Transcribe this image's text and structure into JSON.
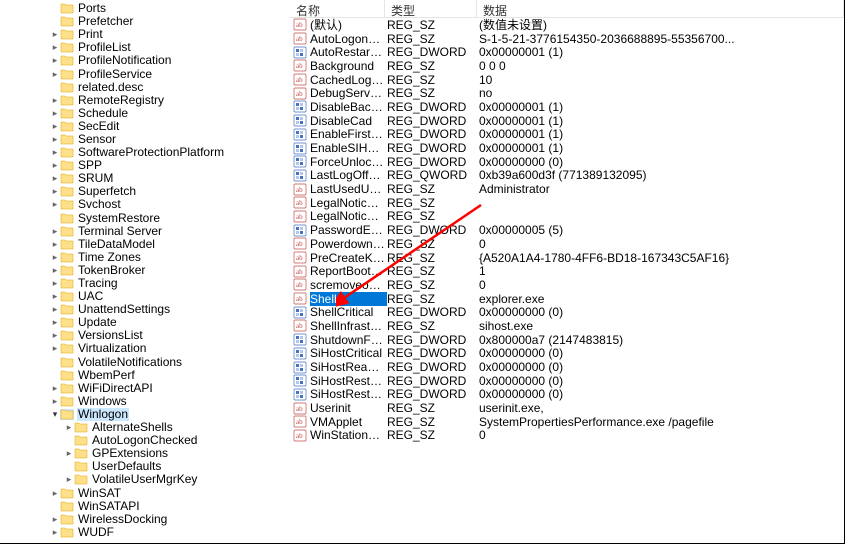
{
  "tree": {
    "items": [
      {
        "label": "Ports",
        "depth": 1,
        "exp": false,
        "arrow": false
      },
      {
        "label": "Prefetcher",
        "depth": 1,
        "exp": false,
        "arrow": false
      },
      {
        "label": "Print",
        "depth": 1,
        "exp": false,
        "arrow": true
      },
      {
        "label": "ProfileList",
        "depth": 1,
        "exp": false,
        "arrow": true
      },
      {
        "label": "ProfileNotification",
        "depth": 1,
        "exp": false,
        "arrow": true
      },
      {
        "label": "ProfileService",
        "depth": 1,
        "exp": false,
        "arrow": true
      },
      {
        "label": "related.desc",
        "depth": 1,
        "exp": false,
        "arrow": false
      },
      {
        "label": "RemoteRegistry",
        "depth": 1,
        "exp": false,
        "arrow": true
      },
      {
        "label": "Schedule",
        "depth": 1,
        "exp": false,
        "arrow": true
      },
      {
        "label": "SecEdit",
        "depth": 1,
        "exp": false,
        "arrow": true
      },
      {
        "label": "Sensor",
        "depth": 1,
        "exp": false,
        "arrow": true
      },
      {
        "label": "SoftwareProtectionPlatform",
        "depth": 1,
        "exp": false,
        "arrow": true
      },
      {
        "label": "SPP",
        "depth": 1,
        "exp": false,
        "arrow": true
      },
      {
        "label": "SRUM",
        "depth": 1,
        "exp": false,
        "arrow": true
      },
      {
        "label": "Superfetch",
        "depth": 1,
        "exp": false,
        "arrow": true
      },
      {
        "label": "Svchost",
        "depth": 1,
        "exp": false,
        "arrow": true
      },
      {
        "label": "SystemRestore",
        "depth": 1,
        "exp": false,
        "arrow": false
      },
      {
        "label": "Terminal Server",
        "depth": 1,
        "exp": false,
        "arrow": true
      },
      {
        "label": "TileDataModel",
        "depth": 1,
        "exp": false,
        "arrow": true
      },
      {
        "label": "Time Zones",
        "depth": 1,
        "exp": false,
        "arrow": true
      },
      {
        "label": "TokenBroker",
        "depth": 1,
        "exp": false,
        "arrow": true
      },
      {
        "label": "Tracing",
        "depth": 1,
        "exp": false,
        "arrow": true
      },
      {
        "label": "UAC",
        "depth": 1,
        "exp": false,
        "arrow": true
      },
      {
        "label": "UnattendSettings",
        "depth": 1,
        "exp": false,
        "arrow": true
      },
      {
        "label": "Update",
        "depth": 1,
        "exp": false,
        "arrow": true
      },
      {
        "label": "VersionsList",
        "depth": 1,
        "exp": false,
        "arrow": true
      },
      {
        "label": "Virtualization",
        "depth": 1,
        "exp": false,
        "arrow": true
      },
      {
        "label": "VolatileNotifications",
        "depth": 1,
        "exp": false,
        "arrow": false
      },
      {
        "label": "WbemPerf",
        "depth": 1,
        "exp": false,
        "arrow": false
      },
      {
        "label": "WiFiDirectAPI",
        "depth": 1,
        "exp": false,
        "arrow": true
      },
      {
        "label": "Windows",
        "depth": 1,
        "exp": false,
        "arrow": true
      },
      {
        "label": "Winlogon",
        "depth": 1,
        "exp": true,
        "arrow": true,
        "selected": true
      },
      {
        "label": "AlternateShells",
        "depth": 2,
        "exp": false,
        "arrow": true
      },
      {
        "label": "AutoLogonChecked",
        "depth": 2,
        "exp": false,
        "arrow": false
      },
      {
        "label": "GPExtensions",
        "depth": 2,
        "exp": false,
        "arrow": true
      },
      {
        "label": "UserDefaults",
        "depth": 2,
        "exp": false,
        "arrow": false
      },
      {
        "label": "VolatileUserMgrKey",
        "depth": 2,
        "exp": false,
        "arrow": true
      },
      {
        "label": "WinSAT",
        "depth": 1,
        "exp": false,
        "arrow": true
      },
      {
        "label": "WinSATAPI",
        "depth": 1,
        "exp": false,
        "arrow": false
      },
      {
        "label": "WirelessDocking",
        "depth": 1,
        "exp": false,
        "arrow": true
      },
      {
        "label": "WUDF",
        "depth": 1,
        "exp": false,
        "arrow": true
      }
    ]
  },
  "list": {
    "headers": {
      "name": "名称",
      "type": "类型",
      "data": "数据"
    },
    "rows": [
      {
        "icon": "sz",
        "name": "(默认)",
        "type": "REG_SZ",
        "data": "(数值未设置)"
      },
      {
        "icon": "sz",
        "name": "AutoLogonSID",
        "type": "REG_SZ",
        "data": "S-1-5-21-3776154350-2036688895-55356700..."
      },
      {
        "icon": "dw",
        "name": "AutoRestartShell",
        "type": "REG_DWORD",
        "data": "0x00000001 (1)"
      },
      {
        "icon": "sz",
        "name": "Background",
        "type": "REG_SZ",
        "data": "0 0 0"
      },
      {
        "icon": "sz",
        "name": "CachedLogons...",
        "type": "REG_SZ",
        "data": "10"
      },
      {
        "icon": "sz",
        "name": "DebugServerCo...",
        "type": "REG_SZ",
        "data": "no"
      },
      {
        "icon": "dw",
        "name": "DisableBackBut...",
        "type": "REG_DWORD",
        "data": "0x00000001 (1)"
      },
      {
        "icon": "dw",
        "name": "DisableCad",
        "type": "REG_DWORD",
        "data": "0x00000001 (1)"
      },
      {
        "icon": "dw",
        "name": "EnableFirstLogo...",
        "type": "REG_DWORD",
        "data": "0x00000001 (1)"
      },
      {
        "icon": "dw",
        "name": "EnableSIHostIn...",
        "type": "REG_DWORD",
        "data": "0x00000001 (1)"
      },
      {
        "icon": "dw",
        "name": "ForceUnlockLo...",
        "type": "REG_DWORD",
        "data": "0x00000000 (0)"
      },
      {
        "icon": "dw",
        "name": "LastLogOffEndT...",
        "type": "REG_QWORD",
        "data": "0xb39a600d3f (771389132095)"
      },
      {
        "icon": "sz",
        "name": "LastUsedUsern...",
        "type": "REG_SZ",
        "data": "Administrator"
      },
      {
        "icon": "sz",
        "name": "LegalNoticeCap...",
        "type": "REG_SZ",
        "data": ""
      },
      {
        "icon": "sz",
        "name": "LegalNoticeText",
        "type": "REG_SZ",
        "data": ""
      },
      {
        "icon": "dw",
        "name": "PasswordExpiry...",
        "type": "REG_DWORD",
        "data": "0x00000005 (5)"
      },
      {
        "icon": "sz",
        "name": "PowerdownAfte...",
        "type": "REG_SZ",
        "data": "0"
      },
      {
        "icon": "sz",
        "name": "PreCreateKnow...",
        "type": "REG_SZ",
        "data": "{A520A1A4-1780-4FF6-BD18-167343C5AF16}"
      },
      {
        "icon": "sz",
        "name": "ReportBootOk",
        "type": "REG_SZ",
        "data": "1"
      },
      {
        "icon": "sz",
        "name": "scremoveoption",
        "type": "REG_SZ",
        "data": "0"
      },
      {
        "icon": "sz",
        "name": "Shell",
        "type": "REG_SZ",
        "data": "explorer.exe",
        "selected": true
      },
      {
        "icon": "dw",
        "name": "ShellCritical",
        "type": "REG_DWORD",
        "data": "0x00000000 (0)"
      },
      {
        "icon": "sz",
        "name": "ShellInfrastruct...",
        "type": "REG_SZ",
        "data": "sihost.exe"
      },
      {
        "icon": "dw",
        "name": "ShutdownFlags",
        "type": "REG_DWORD",
        "data": "0x800000a7 (2147483815)"
      },
      {
        "icon": "dw",
        "name": "SiHostCritical",
        "type": "REG_DWORD",
        "data": "0x00000000 (0)"
      },
      {
        "icon": "dw",
        "name": "SiHostReadyTi...",
        "type": "REG_DWORD",
        "data": "0x00000000 (0)"
      },
      {
        "icon": "dw",
        "name": "SiHostRestartC...",
        "type": "REG_DWORD",
        "data": "0x00000000 (0)"
      },
      {
        "icon": "dw",
        "name": "SiHostRestartTi...",
        "type": "REG_DWORD",
        "data": "0x00000000 (0)"
      },
      {
        "icon": "sz",
        "name": "Userinit",
        "type": "REG_SZ",
        "data": "userinit.exe,"
      },
      {
        "icon": "sz",
        "name": "VMApplet",
        "type": "REG_SZ",
        "data": "SystemPropertiesPerformance.exe /pagefile"
      },
      {
        "icon": "sz",
        "name": "WinStationsDis...",
        "type": "REG_SZ",
        "data": "0"
      }
    ]
  }
}
